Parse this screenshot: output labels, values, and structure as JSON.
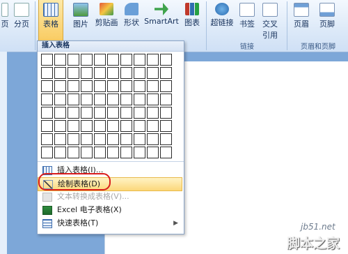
{
  "ribbon": {
    "page_break_prefix": "页",
    "page_break": "分页",
    "table": "表格",
    "picture": "图片",
    "clipart": "剪贴画",
    "shapes": "形状",
    "smartart": "SmartArt",
    "chart": "图表",
    "hyperlink": "超链接",
    "bookmark": "书签",
    "crossref_1": "交叉",
    "crossref_2": "引用",
    "header": "页眉",
    "footer": "页脚",
    "group_links": "链接",
    "group_header_footer": "页眉和页脚"
  },
  "menu": {
    "title": "插入表格",
    "grid_cols": 10,
    "grid_rows": 8,
    "items": [
      {
        "label": "插入表格(I)...",
        "icon": "insert-table-icon"
      },
      {
        "label": "绘制表格(D)",
        "icon": "draw-table-icon"
      },
      {
        "label": "文本转换成表格(V)...",
        "icon": "convert-text-icon"
      },
      {
        "label": "Excel 电子表格(X)",
        "icon": "excel-icon"
      },
      {
        "label": "快速表格(T)",
        "icon": "quick-table-icon"
      }
    ]
  },
  "watermark": {
    "site": "jb51.net",
    "brand": "脚本之家"
  },
  "colors": {
    "highlight": "#fbd77a",
    "annotation": "#d91c1c",
    "ribbon": "#dce9f8"
  }
}
